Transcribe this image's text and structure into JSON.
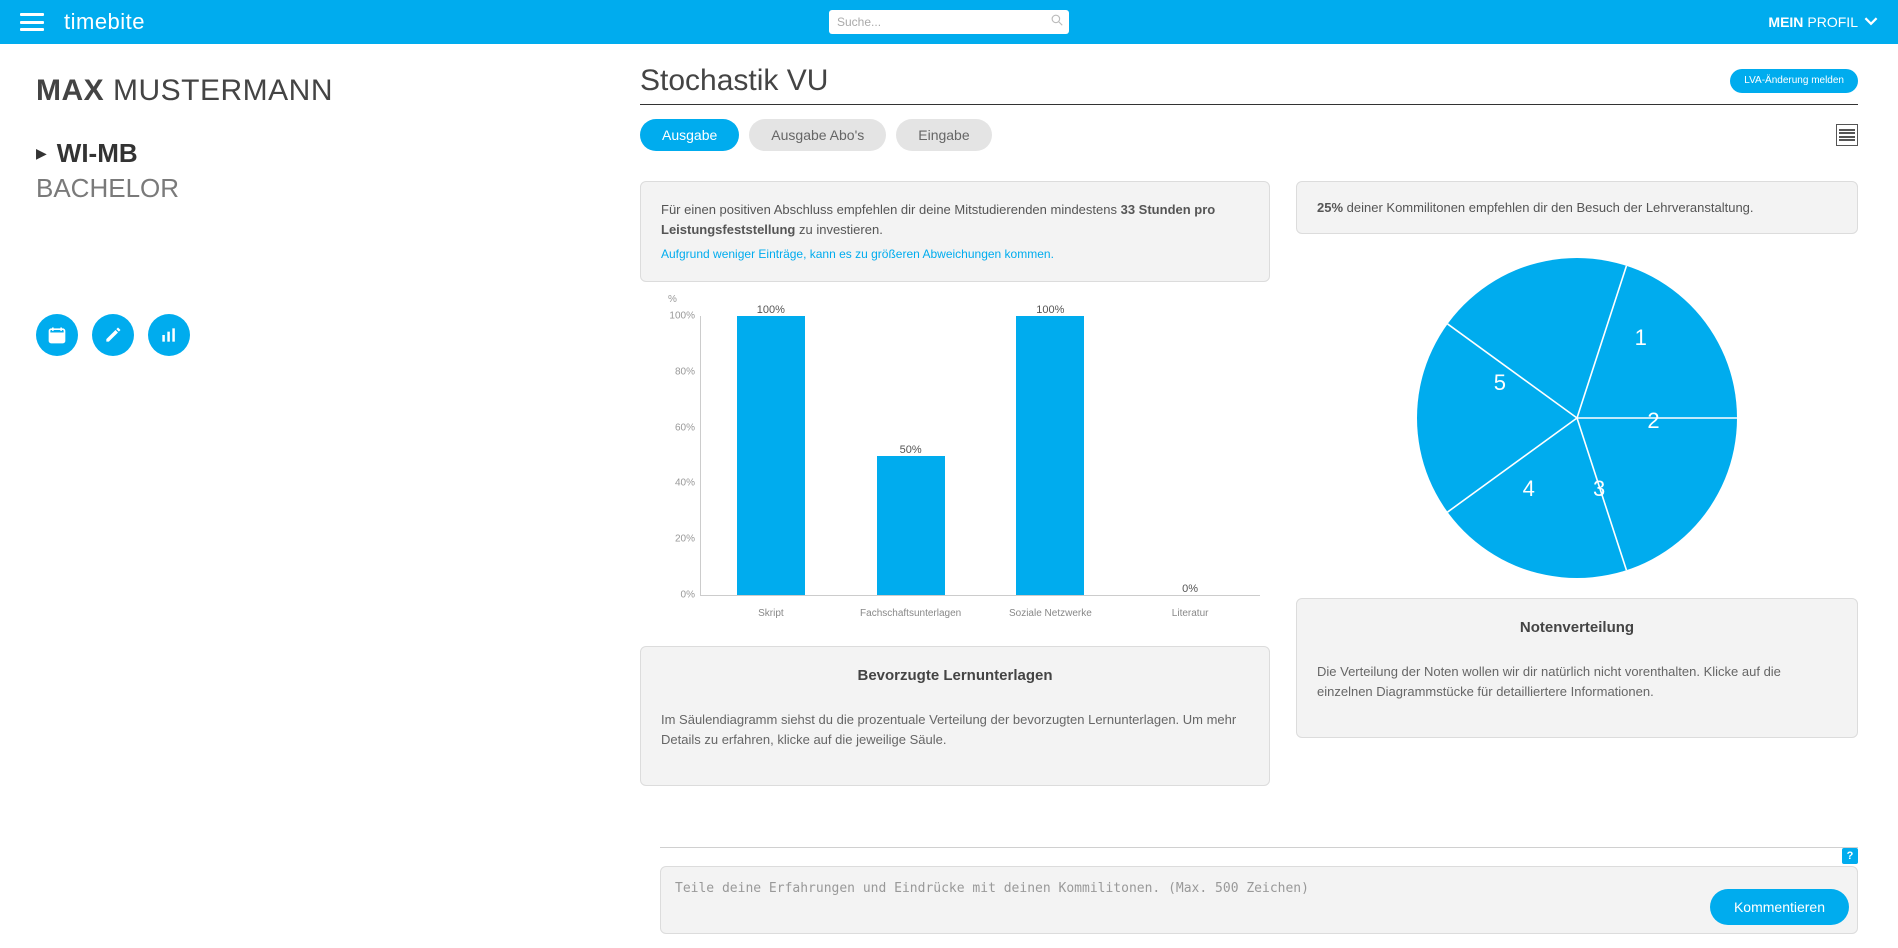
{
  "header": {
    "logo": "timebite",
    "search_placeholder": "Suche...",
    "profile_bold": "MEIN",
    "profile_light": "PROFIL"
  },
  "sidebar": {
    "user_first": "MAX",
    "user_last": "MUSTERMANN",
    "study_code": "WI-MB",
    "degree": "BACHELOR"
  },
  "main": {
    "course_title": "Stochastik VU",
    "report_button": "LVA-Änderung melden",
    "tabs": {
      "ausgabe": "Ausgabe",
      "abos": "Ausgabe Abo's",
      "eingabe": "Eingabe"
    },
    "info_left_pre": "Für einen positiven Abschluss empfehlen dir deine Mitstudierenden mindestens ",
    "info_left_bold": "33 Stunden pro Leistungsfeststellung",
    "info_left_post": " zu investieren.",
    "info_left_note": "Aufgrund weniger Einträge, kann es zu größeren Abweichungen kommen.",
    "info_right_bold": "25%",
    "info_right_rest": " deiner Kommilitonen empfehlen dir den Besuch der Lehrveranstaltung.",
    "bar_desc_title": "Bevorzugte Lernunterlagen",
    "bar_desc_text": "Im Säulendiagramm siehst du die prozentuale Verteilung der bevorzugten Lernunterlagen. Um mehr Details zu erfahren, klicke auf die jeweilige Säule.",
    "pie_desc_title": "Notenverteilung",
    "pie_desc_text": "Die Verteilung der Noten wollen wir dir natürlich nicht vorenthalten. Klicke auf die einzelnen Diagrammstücke für detailliertere Informationen."
  },
  "chart_data": [
    {
      "type": "bar",
      "title": "Bevorzugte Lernunterlagen",
      "ylabel": "%",
      "ylim": [
        0,
        100
      ],
      "yticks": [
        "0%",
        "20%",
        "40%",
        "60%",
        "80%",
        "100%"
      ],
      "categories": [
        "Skript",
        "Fachschaftsunterlagen",
        "Soziale Netzwerke",
        "Literatur"
      ],
      "values": [
        100,
        50,
        100,
        0
      ],
      "value_labels": [
        "100%",
        "50%",
        "100%",
        "0%"
      ]
    },
    {
      "type": "pie",
      "title": "Notenverteilung",
      "categories": [
        "1",
        "2",
        "3",
        "4",
        "5"
      ],
      "values": [
        20,
        20,
        20,
        20,
        20
      ]
    }
  ],
  "comment": {
    "placeholder": "Teile deine Erfahrungen und Eindrücke mit deinen Kommilitonen. (Max. 500 Zeichen)",
    "button": "Kommentieren"
  }
}
